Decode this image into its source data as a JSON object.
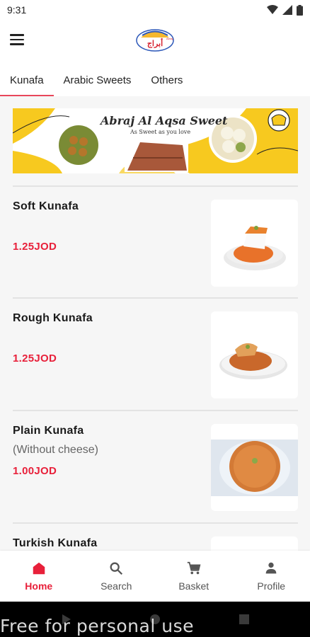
{
  "status": {
    "time": "9:31"
  },
  "logo": {
    "alt": "Abraj logo"
  },
  "tabs": [
    {
      "label": "Kunafa",
      "active": true
    },
    {
      "label": "Arabic Sweets",
      "active": false
    },
    {
      "label": "Others",
      "active": false
    }
  ],
  "banner": {
    "title": "Abraj Al Aqsa Sweet",
    "subtitle": "As Sweet as you love"
  },
  "items": [
    {
      "name": "Soft  Kunafa",
      "desc": "",
      "price": "1.25JOD"
    },
    {
      "name": "Rough Kunafa",
      "desc": "",
      "price": "1.25JOD"
    },
    {
      "name": "Plain Kunafa",
      "desc": "(Without cheese)",
      "price": "1.00JOD"
    },
    {
      "name": "Turkish Kunafa",
      "desc": "",
      "price": ""
    }
  ],
  "nav": {
    "home": "Home",
    "search": "Search",
    "basket": "Basket",
    "profile": "Profile"
  },
  "watermark": "Free for personal use",
  "colors": {
    "accent": "#e8203a",
    "banner_yellow": "#f7c91f",
    "background": "#f6f6f6"
  }
}
